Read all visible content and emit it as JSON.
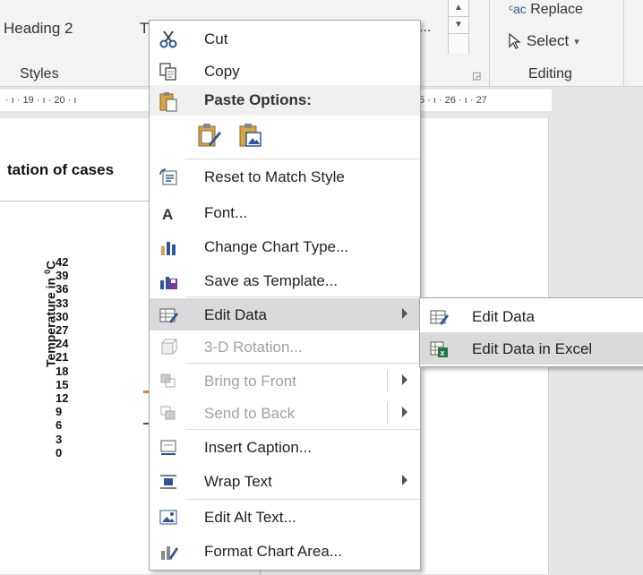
{
  "ribbon": {
    "heading2": "Heading 2",
    "heading_t": "T",
    "styles_label": "Styles",
    "dots": "...",
    "replace_label": "Replace",
    "replace_prefix": "ac",
    "select_label": "Select",
    "editing_label": "Editing"
  },
  "ruler": {
    "left_text": "· ı · 19 · ı · 20 · ı",
    "right_text": "5 · ı · 26 · ı · 27"
  },
  "document": {
    "title": "tation of cases",
    "y_axis_label": "Temperature in",
    "y_axis_unit": "0",
    "y_axis_unit_suffix": "C",
    "y_ticks": [
      "42",
      "39",
      "36",
      "33",
      "30",
      "27",
      "24",
      "21",
      "18",
      "15",
      "12",
      "9",
      "6",
      "3",
      "0"
    ]
  },
  "context_menu": {
    "cut": "Cut",
    "copy": "Copy",
    "paste_options": "Paste Options:",
    "reset_style": "Reset to Match Style",
    "font": "Font...",
    "change_chart_type": "Change Chart Type...",
    "save_template": "Save as Template...",
    "edit_data": "Edit Data",
    "rotation_3d": "3-D Rotation...",
    "bring_front": "Bring to Front",
    "send_back": "Send to Back",
    "insert_caption": "Insert Caption...",
    "wrap_text": "Wrap Text",
    "edit_alt_text": "Edit Alt Text...",
    "format_chart_area": "Format Chart Area..."
  },
  "submenu": {
    "edit_data": "Edit Data",
    "edit_data_excel": "Edit Data in Excel"
  },
  "colors": {
    "hover_bg": "#dadada",
    "disabled_text": "#a0a0a0",
    "accent_blue": "#2b579a",
    "excel_green": "#217346"
  }
}
